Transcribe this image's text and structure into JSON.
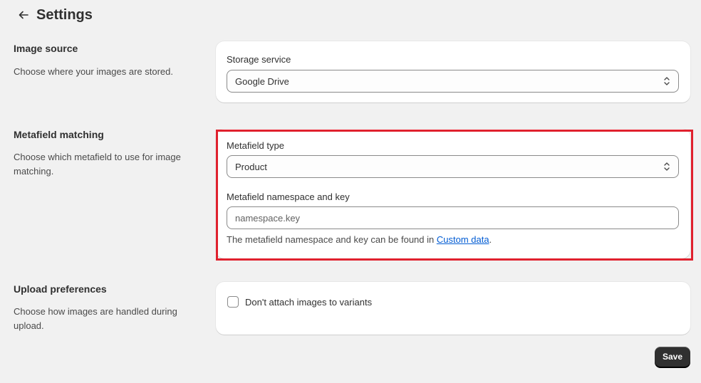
{
  "header": {
    "back_icon": "arrow-left-icon",
    "title": "Settings"
  },
  "image_source": {
    "heading": "Image source",
    "description": "Choose where your images are stored.",
    "storage_label": "Storage service",
    "storage_value": "Google Drive"
  },
  "metafield_matching": {
    "heading": "Metafield matching",
    "description": "Choose which metafield to use for image matching.",
    "type_label": "Metafield type",
    "type_value": "Product",
    "key_label": "Metafield namespace and key",
    "key_placeholder": "namespace.key",
    "key_value": "",
    "help_prefix": "The metafield namespace and key can be found in ",
    "help_link": "Custom data",
    "help_suffix": "."
  },
  "upload_preferences": {
    "heading": "Upload preferences",
    "description": "Choose how images are handled during upload.",
    "checkbox_label": "Don't attach images to variants",
    "checkbox_checked": false
  },
  "footer": {
    "save_label": "Save"
  },
  "colors": {
    "highlight": "#e0212e",
    "link": "#005bd3",
    "primary_button": "#303030",
    "background": "#f1f1f1"
  }
}
